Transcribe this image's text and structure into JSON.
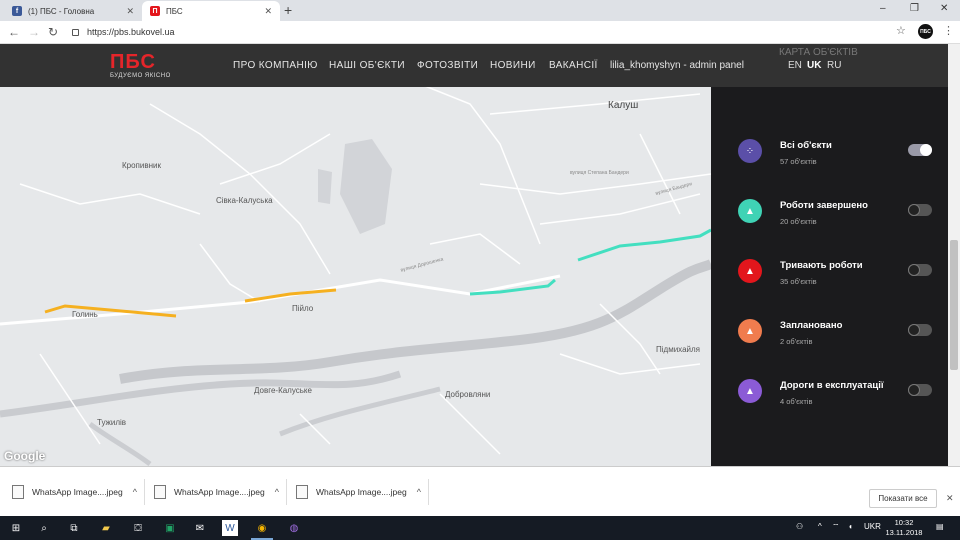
{
  "browser": {
    "tabs": [
      {
        "title": "(1) ПБС - Головна",
        "favicon": "facebook-icon",
        "active": false
      },
      {
        "title": "ПБС",
        "favicon": "pbs-icon",
        "active": true
      }
    ],
    "new_tab": "+",
    "window_controls": {
      "minimize": "–",
      "maximize": "❐",
      "close": "✕"
    },
    "url": "https://pbs.bukovel.ua",
    "ext_label": "ПБС"
  },
  "site": {
    "logo": "ПБС",
    "tagline": "БУДУЄМО ЯКІСНО",
    "nav": [
      "ПРО КОМПАНІЮ",
      "НАШІ ОБ'ЄКТИ",
      "ФОТОЗВІТИ",
      "НОВИНИ",
      "ВАКАНСІЇ",
      "lilia_khomyshyn - admin panel"
    ],
    "languages": [
      "EN",
      "UK",
      "RU"
    ],
    "active_language": "UK"
  },
  "panel": {
    "ghost_title": "КАРТА ОБ'ЄКТІВ",
    "categories": [
      {
        "name": "Всі об'єкти",
        "count": "57 об'єктів",
        "color": "#5b4fa8",
        "icon": "all-objects-icon",
        "on": true
      },
      {
        "name": "Роботи завершено",
        "count": "20 об'єктів",
        "color": "#3fd3b5",
        "icon": "cone-icon",
        "on": false
      },
      {
        "name": "Тривають роботи",
        "count": "35 об'єктів",
        "color": "#e3161c",
        "icon": "cone-icon",
        "on": false
      },
      {
        "name": "Заплановано",
        "count": "2 об'єктів",
        "color": "#f07c4e",
        "icon": "cone-icon",
        "on": false
      },
      {
        "name": "Дороги в експлуатації",
        "count": "4 об'єктів",
        "color": "#8b5bd6",
        "icon": "cone-icon",
        "on": false
      }
    ]
  },
  "map": {
    "labels": [
      "Калуш",
      "Кропивник",
      "Сівка-Калуська",
      "Голинь",
      "Пійло",
      "Підмихайля",
      "Довге-Калуське",
      "Добровляни",
      "Тужилів"
    ],
    "road_labels": [
      "вулиця Степана Бандери",
      "вулиця Дорошенка",
      "вулиця Бандери"
    ],
    "attribution": "Google",
    "colors": {
      "completed": "#43dfc0",
      "planned": "#f5b020"
    }
  },
  "downloads": {
    "items": [
      "WhatsApp Image....jpeg",
      "WhatsApp Image....jpeg",
      "WhatsApp Image....jpeg"
    ],
    "show_all": "Показати все"
  },
  "taskbar": {
    "language": "UKR",
    "time": "10:32",
    "date": "13.11.2018"
  }
}
